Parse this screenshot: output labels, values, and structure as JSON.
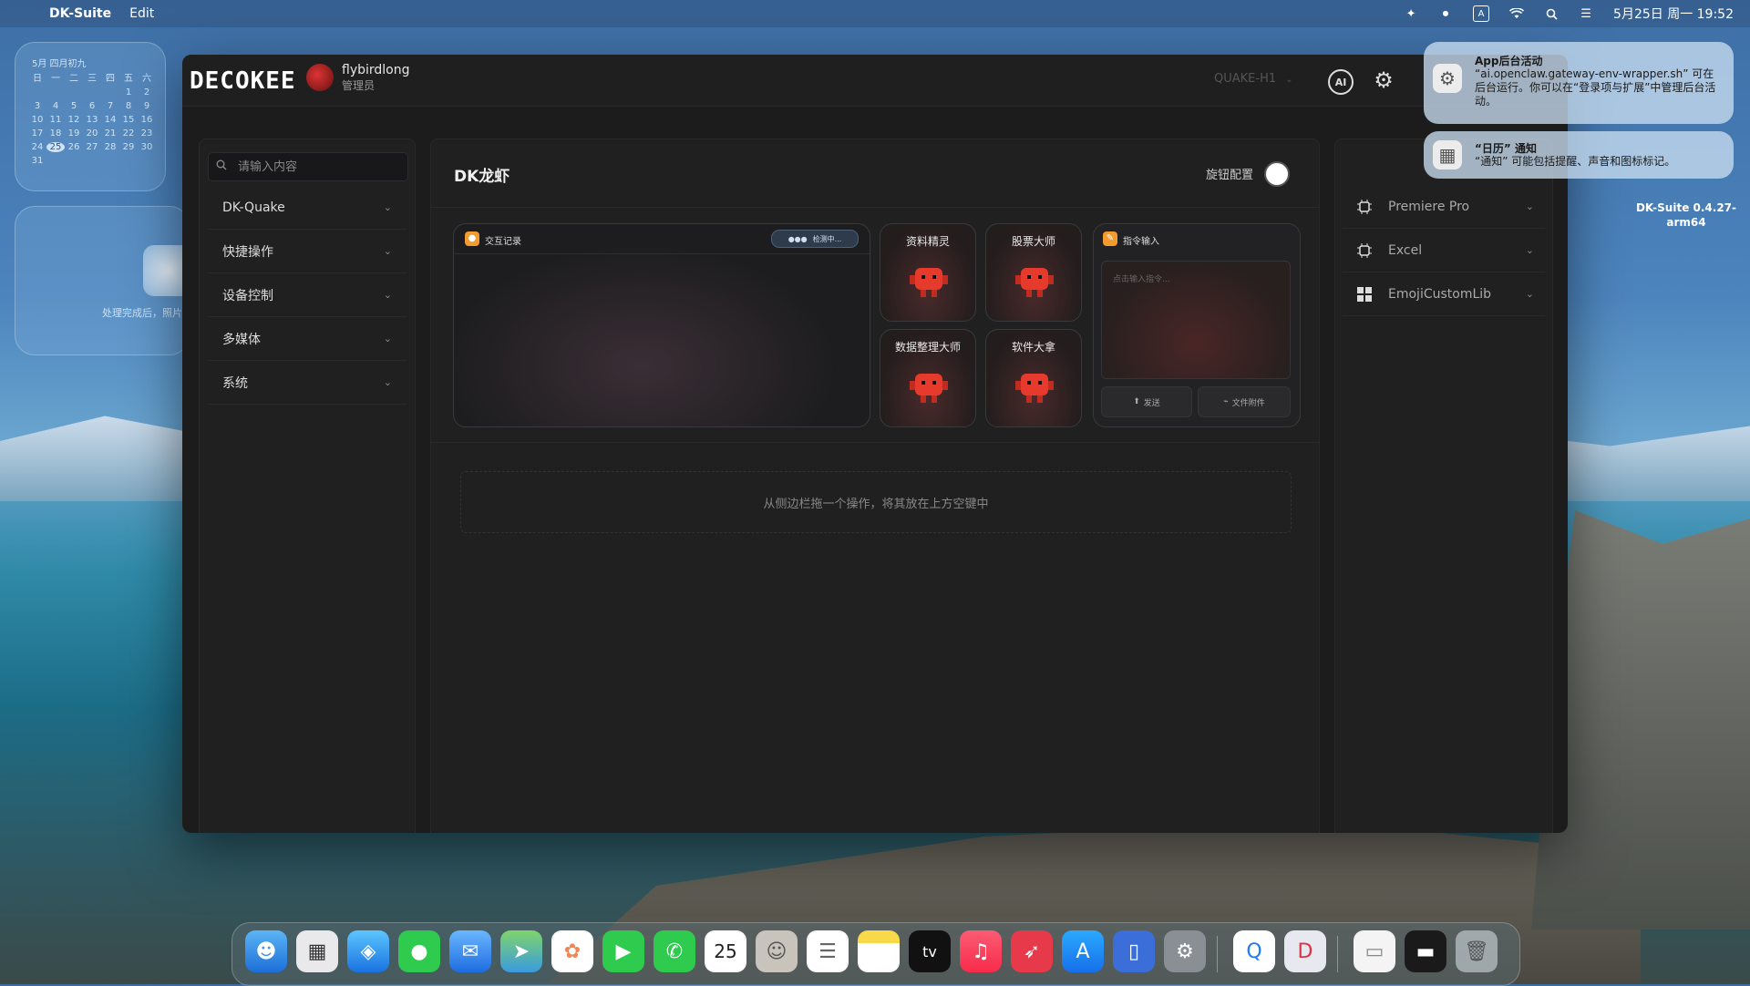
{
  "menubar": {
    "app_name": "DK-Suite",
    "menu_edit": "Edit",
    "input_indicator": "A",
    "datetime": "5月25日 周一  19:52"
  },
  "calendar_widget": {
    "header": "5月  四月初九",
    "weekdays": [
      "日",
      "一",
      "二",
      "三",
      "四",
      "五",
      "六"
    ],
    "days": [
      "",
      "",
      "",
      "",
      "",
      "1",
      "2",
      "3",
      "4",
      "5",
      "6",
      "7",
      "8",
      "9",
      "10",
      "11",
      "12",
      "13",
      "14",
      "15",
      "16",
      "17",
      "18",
      "19",
      "20",
      "21",
      "22",
      "23",
      "24",
      "25",
      "26",
      "27",
      "28",
      "29",
      "30",
      "31"
    ],
    "today": "25"
  },
  "photo_widget": {
    "text": "处理完成后，照片"
  },
  "app": {
    "logo": "DECOKEE",
    "user_name": "flybirdlong",
    "user_role": "管理员",
    "device": "QUAKE-H1",
    "ai_label": "AI"
  },
  "sidebar": {
    "search_placeholder": "请输入内容",
    "items": [
      {
        "label": "DK-Quake"
      },
      {
        "label": "快捷操作"
      },
      {
        "label": "设备控制"
      },
      {
        "label": "多媒体"
      },
      {
        "label": "系统"
      }
    ]
  },
  "center": {
    "title": "DK龙虾",
    "knob_label": "旋钮配置",
    "log_panel": {
      "title": "交互记录",
      "badge": "检测中..."
    },
    "keys": [
      {
        "label": "资料精灵"
      },
      {
        "label": "股票大师"
      },
      {
        "label": "数据整理大师"
      },
      {
        "label": "软件大拿"
      }
    ],
    "cmd_panel": {
      "title": "指令输入",
      "placeholder": "点击输入指令...",
      "send": "发送",
      "attach": "文件附件"
    },
    "drop_hint": "从侧边栏拖一个操作，将其放在上方空键中"
  },
  "right_panel": {
    "items": [
      {
        "label": "Premiere Pro",
        "icon": "chip-icon"
      },
      {
        "label": "Excel",
        "icon": "chip-icon"
      },
      {
        "label": "EmojiCustomLib",
        "icon": "grid-icon"
      }
    ]
  },
  "notifications": [
    {
      "title": "App后台活动",
      "body": "“ai.openclaw.gateway-env-wrapper.sh” 可在后台运行。你可以在“登录项与扩展”中管理后台活动。"
    },
    {
      "title": "“日历” 通知",
      "body": "“通知” 可能包括提醒、声音和图标标记。"
    }
  ],
  "version_label": {
    "line1": "DK-Suite 0.4.27-",
    "line2": "arm64"
  },
  "dock": {
    "items": [
      "Finder",
      "Launchpad",
      "Safari",
      "Messages",
      "Mail",
      "Maps",
      "Photos",
      "FaceTime",
      "Phone",
      "Calendar",
      "Contacts",
      "Reminders",
      "Notes",
      "TV",
      "Music",
      "Rocket",
      "App Store",
      "iPhone Mirroring",
      "System Settings",
      "QuickQ",
      "DK-Suite",
      "Document",
      "Terminal",
      "Trash"
    ],
    "calendar_date": "25",
    "tv_label": "tv"
  }
}
